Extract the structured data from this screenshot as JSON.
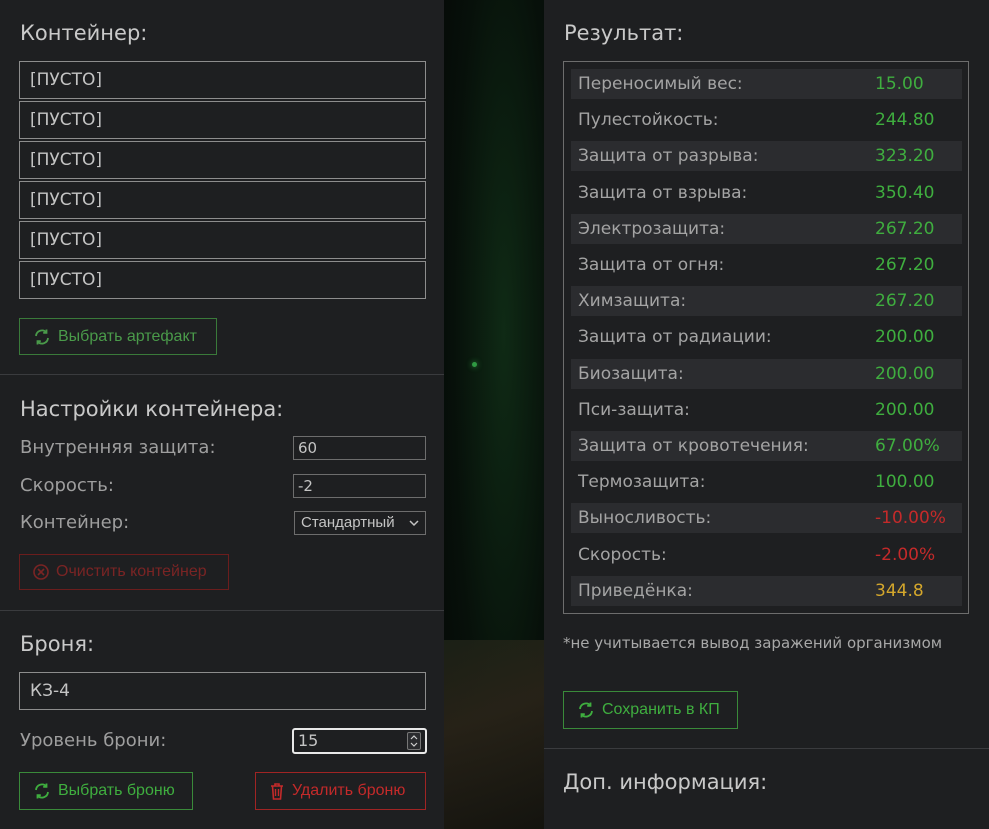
{
  "container": {
    "title": "Контейнер:",
    "slots": [
      "[ПУСТО]",
      "[ПУСТО]",
      "[ПУСТО]",
      "[ПУСТО]",
      "[ПУСТО]",
      "[ПУСТО]"
    ],
    "select_artifact_label": "Выбрать артефакт"
  },
  "container_settings": {
    "title": "Настройки контейнера:",
    "inner_protection_label": "Внутренняя защита:",
    "inner_protection_value": "60",
    "speed_label": "Скорость:",
    "speed_value": "-2",
    "container_label": "Контейнер:",
    "container_value": "Стандартный",
    "clear_label": "Очистить контейнер"
  },
  "armor": {
    "title": "Броня:",
    "name": "КЗ-4",
    "level_label": "Уровень брони:",
    "level_value": "15",
    "select_label": "Выбрать броню",
    "delete_label": "Удалить броню"
  },
  "result": {
    "title": "Результат:",
    "rows": [
      {
        "label": "Переносимый вес:",
        "value": "15.00",
        "color": "#3fae3f"
      },
      {
        "label": "Пулестойкость:",
        "value": "244.80",
        "color": "#3fae3f"
      },
      {
        "label": "Защита от разрыва:",
        "value": "323.20",
        "color": "#3fae3f"
      },
      {
        "label": "Защита от взрыва:",
        "value": "350.40",
        "color": "#3fae3f"
      },
      {
        "label": "Электрозащита:",
        "value": "267.20",
        "color": "#3fae3f"
      },
      {
        "label": "Защита от огня:",
        "value": "267.20",
        "color": "#3fae3f"
      },
      {
        "label": "Химзащита:",
        "value": "267.20",
        "color": "#3fae3f"
      },
      {
        "label": "Защита от радиации:",
        "value": "200.00",
        "color": "#3fae3f"
      },
      {
        "label": "Биозащита:",
        "value": "200.00",
        "color": "#3fae3f"
      },
      {
        "label": "Пси-защита:",
        "value": "200.00",
        "color": "#3fae3f"
      },
      {
        "label": "Защита от кровотечения:",
        "value": "67.00%",
        "color": "#3fae3f"
      },
      {
        "label": "Термозащита:",
        "value": "100.00",
        "color": "#3fae3f"
      },
      {
        "label": "Выносливость:",
        "value": "-10.00%",
        "color": "#c42a2a"
      },
      {
        "label": "Скорость:",
        "value": "-2.00%",
        "color": "#c42a2a"
      },
      {
        "label": "Приведёнка:",
        "value": "344.8",
        "color": "#d4a72c"
      }
    ],
    "note": "*не учитывается вывод заражений организмом",
    "save_label": "Сохранить в КП"
  },
  "extra": {
    "title": "Доп. информация:"
  }
}
